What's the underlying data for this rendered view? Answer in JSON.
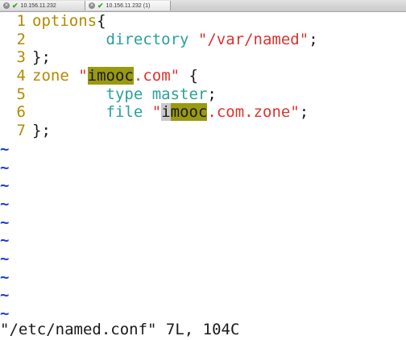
{
  "tabs": [
    {
      "label": "10.156.11.232",
      "status_icon": "check-icon"
    },
    {
      "label": "10.156.11.232 (1)",
      "status_icon": "check-icon"
    }
  ],
  "colors": {
    "line_number": "#b58900",
    "statement": "#b58900",
    "type_keyword": "#2aa198",
    "string": "#dc322f",
    "search_highlight": "#9a9a10",
    "tilde": "#1e3ccf"
  },
  "editor": {
    "lines": [
      {
        "num": "1",
        "text": "options{"
      },
      {
        "num": "2",
        "text": "        directory \"/var/named\";"
      },
      {
        "num": "3",
        "text": "};"
      },
      {
        "num": "4",
        "text": "zone \"imooc.com\" {"
      },
      {
        "num": "5",
        "text": "        type master;"
      },
      {
        "num": "6",
        "text": "        file \"imooc.com.zone\";"
      },
      {
        "num": "7",
        "text": "};"
      }
    ],
    "tokens": {
      "l1_kw": "options",
      "l1_brace": "{",
      "l2_kw": "directory",
      "l2_str": "\"/var/named\"",
      "l2_semi": ";",
      "l3_text": "};",
      "l4_kw": "zone",
      "l4_q1": "\"",
      "l4_match": "imooc",
      "l4_rest": ".com\"",
      "l4_brace": "{",
      "l5_kw": "type",
      "l5_val": "master",
      "l5_semi": ";",
      "l6_kw": "file",
      "l6_q1": "\"",
      "l6_cursor": "i",
      "l6_match": "mooc",
      "l6_rest": ".com.zone\"",
      "l6_semi": ";",
      "l7_text": "};"
    },
    "tilde_char": "~",
    "tilde_count": 10
  },
  "status_line": "\"/etc/named.conf\" 7L, 104C"
}
